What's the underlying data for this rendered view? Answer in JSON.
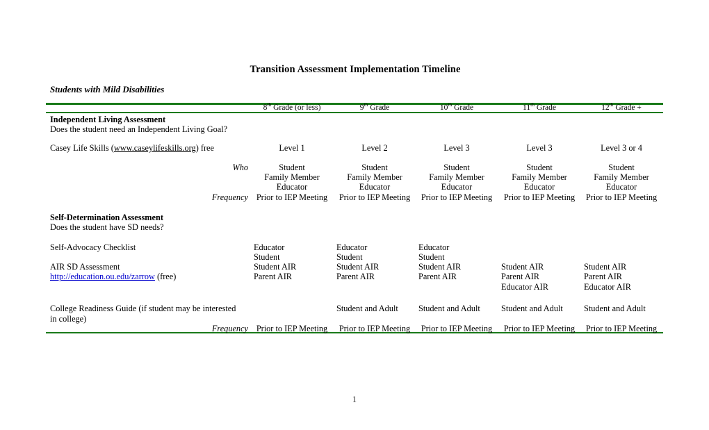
{
  "document": {
    "title": "Transition Assessment Implementation Timeline",
    "subtitle": "Students with Mild Disabilities",
    "page_number": "1",
    "accent_color": "#1a7a1a",
    "link_color": "#0000cc"
  },
  "table": {
    "columns": [
      {
        "ordinal": "8",
        "suffix": "th",
        "rest": " Grade (or less)"
      },
      {
        "ordinal": "9",
        "suffix": "th",
        "rest": " Grade"
      },
      {
        "ordinal": "10",
        "suffix": "th",
        "rest": " Grade"
      },
      {
        "ordinal": "11",
        "suffix": "th",
        "rest": " Grade"
      },
      {
        "ordinal": "12",
        "suffix": "th",
        "rest": " Grade +"
      }
    ],
    "row_labels": {
      "who": "Who",
      "frequency": "Frequency"
    }
  },
  "sections": [
    {
      "heading": "Independent Living Assessment",
      "question": "Does the student need an Independent Living Goal?",
      "instrument": {
        "name_prefix": "Casey Life Skills (",
        "link_text": "www.caseylifeskills.org",
        "name_suffix": ") free"
      },
      "levels": [
        "Level 1",
        "Level 2",
        "Level 3",
        "Level 3",
        "Level 3 or 4"
      ],
      "who": [
        [
          "Student",
          "Family Member",
          "Educator"
        ],
        [
          "Student",
          "Family Member",
          "Educator"
        ],
        [
          "Student",
          "Family Member",
          "Educator"
        ],
        [
          "Student",
          "Family Member",
          "Educator"
        ],
        [
          "Student",
          "Family Member",
          "Educator"
        ]
      ],
      "frequency": [
        "Prior to IEP Meeting",
        "Prior to IEP Meeting",
        "Prior to IEP Meeting",
        "Prior to IEP Meeting",
        "Prior to IEP Meeting"
      ]
    },
    {
      "heading": "Self-Determination Assessment",
      "question": "Does the student have SD needs?",
      "items": [
        {
          "label": "Self-Advocacy Checklist",
          "cells": [
            [
              "Educator",
              "Student"
            ],
            [
              "Educator",
              "Student"
            ],
            [
              "Educator",
              "Student"
            ],
            [],
            []
          ]
        },
        {
          "label": "AIR SD Assessment",
          "link_text": "http://education.ou.edu/zarrow",
          "link_suffix": " (free)",
          "cells": [
            [
              "Student AIR",
              "Parent AIR"
            ],
            [
              "Student AIR",
              "Parent AIR"
            ],
            [
              "Student AIR",
              "Parent AIR"
            ],
            [
              "Student AIR",
              "Parent AIR",
              "Educator AIR"
            ],
            [
              "Student AIR",
              "Parent AIR",
              "Educator AIR"
            ]
          ]
        },
        {
          "label_line1": "College Readiness Guide (if student may be interested",
          "label_line2": "in college)",
          "cells": [
            [],
            [
              "Student and Adult"
            ],
            [
              "Student and Adult"
            ],
            [
              "Student and Adult"
            ],
            [
              "Student and Adult"
            ]
          ]
        }
      ],
      "frequency": [
        "Prior to IEP Meeting",
        "Prior to IEP Meeting",
        "Prior to IEP Meeting",
        "Prior to IEP Meeting",
        "Prior to IEP Meeting"
      ]
    }
  ]
}
